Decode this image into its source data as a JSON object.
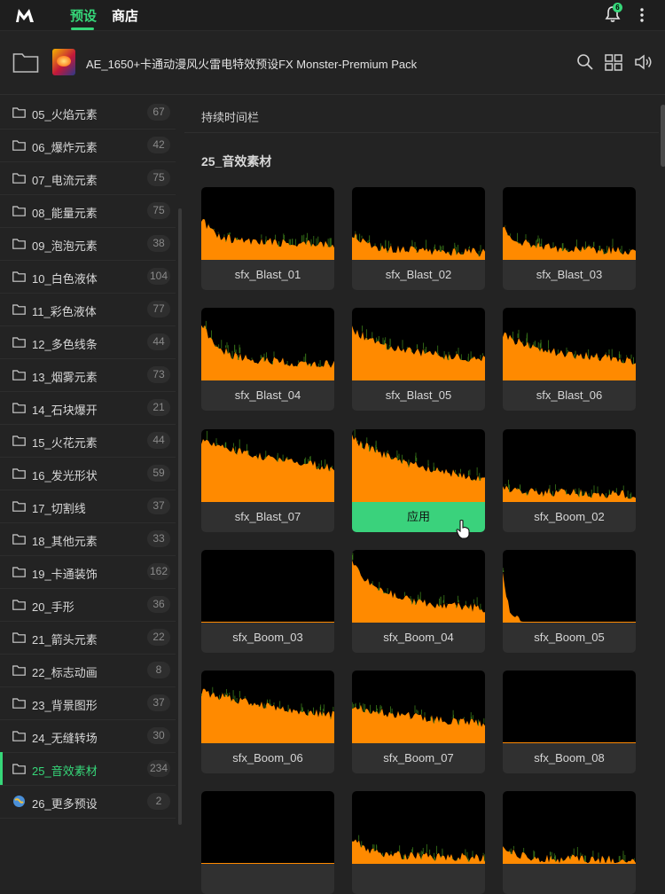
{
  "app": {
    "tabs": [
      {
        "label": "预设",
        "active": true
      },
      {
        "label": "商店",
        "active": false
      }
    ],
    "notification_count": "6",
    "accent_color": "#36d779"
  },
  "header": {
    "pack_title": "AE_1650+卡通动漫风火雷电特效预设FX Monster-Premium Pack"
  },
  "sidebar": {
    "items": [
      {
        "label": "05_火焰元素",
        "count": "67"
      },
      {
        "label": "06_爆炸元素",
        "count": "42"
      },
      {
        "label": "07_电流元素",
        "count": "75"
      },
      {
        "label": "08_能量元素",
        "count": "75"
      },
      {
        "label": "09_泡泡元素",
        "count": "38"
      },
      {
        "label": "10_白色液体",
        "count": "104"
      },
      {
        "label": "11_彩色液体",
        "count": "77"
      },
      {
        "label": "12_多色线条",
        "count": "44"
      },
      {
        "label": "13_烟雾元素",
        "count": "73"
      },
      {
        "label": "14_石块爆开",
        "count": "21"
      },
      {
        "label": "15_火花元素",
        "count": "44"
      },
      {
        "label": "16_发光形状",
        "count": "59"
      },
      {
        "label": "17_切割线",
        "count": "37"
      },
      {
        "label": "18_其他元素",
        "count": "33"
      },
      {
        "label": "19_卡通装饰",
        "count": "162"
      },
      {
        "label": "20_手形",
        "count": "36"
      },
      {
        "label": "21_箭头元素",
        "count": "22"
      },
      {
        "label": "22_标志动画",
        "count": "8"
      },
      {
        "label": "23_背景图形",
        "count": "37"
      },
      {
        "label": "24_无缝转场",
        "count": "30"
      },
      {
        "label": "25_音效素材",
        "count": "234",
        "active": true
      },
      {
        "label": "26_更多预设",
        "count": "2"
      }
    ]
  },
  "main": {
    "section_label": "持续时间栏",
    "group_title": "25_音效素材",
    "apply_label": "应用",
    "cards": [
      {
        "name": "sfx_Blast_01"
      },
      {
        "name": "sfx_Blast_02"
      },
      {
        "name": "sfx_Blast_03"
      },
      {
        "name": "sfx_Blast_04"
      },
      {
        "name": "sfx_Blast_05"
      },
      {
        "name": "sfx_Blast_06"
      },
      {
        "name": "sfx_Blast_07"
      },
      {
        "name": "",
        "hovered": true
      },
      {
        "name": "sfx_Boom_02"
      },
      {
        "name": "sfx_Boom_03"
      },
      {
        "name": "sfx_Boom_04"
      },
      {
        "name": "sfx_Boom_05"
      },
      {
        "name": "sfx_Boom_06"
      },
      {
        "name": "sfx_Boom_07"
      },
      {
        "name": "sfx_Boom_08"
      },
      {
        "name": ""
      },
      {
        "name": ""
      },
      {
        "name": ""
      }
    ]
  }
}
